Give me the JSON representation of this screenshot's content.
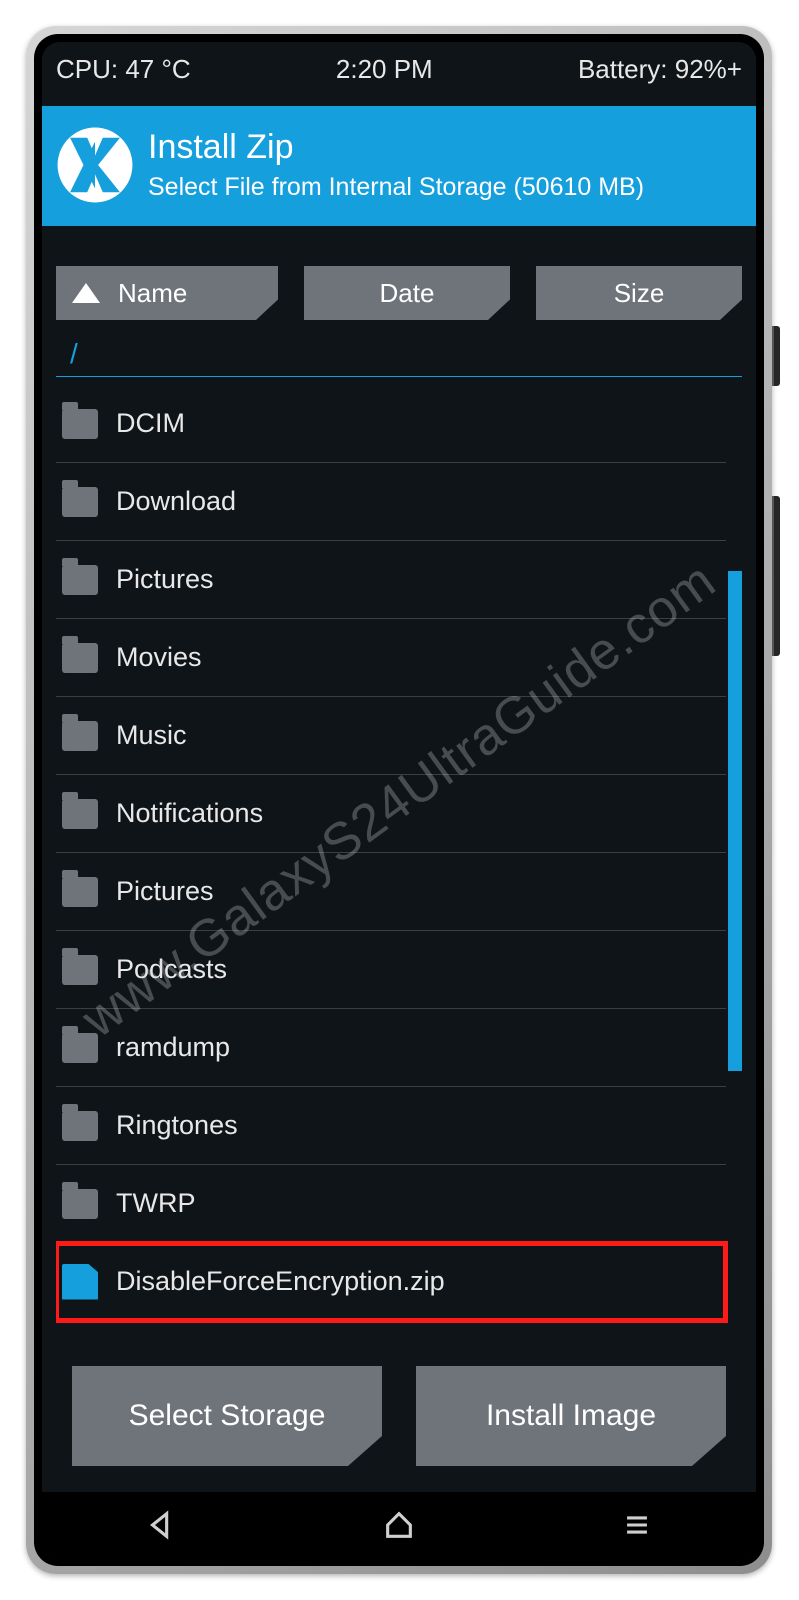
{
  "statusbar": {
    "cpu": "CPU: 47 °C",
    "time": "2:20 PM",
    "battery": "Battery: 92%+"
  },
  "header": {
    "title": "Install Zip",
    "subtitle": "Select File from Internal Storage (50610 MB)"
  },
  "sort": {
    "name": "Name",
    "date": "Date",
    "size": "Size"
  },
  "path": "/",
  "files": [
    {
      "name": "DCIM",
      "type": "folder",
      "highlight": false
    },
    {
      "name": "Download",
      "type": "folder",
      "highlight": false
    },
    {
      "name": "Pictures",
      "type": "folder",
      "highlight": false
    },
    {
      "name": "Movies",
      "type": "folder",
      "highlight": false
    },
    {
      "name": "Music",
      "type": "folder",
      "highlight": false
    },
    {
      "name": "Notifications",
      "type": "folder",
      "highlight": false
    },
    {
      "name": "Pictures",
      "type": "folder",
      "highlight": false
    },
    {
      "name": "Podcasts",
      "type": "folder",
      "highlight": false
    },
    {
      "name": "ramdump",
      "type": "folder",
      "highlight": false
    },
    {
      "name": "Ringtones",
      "type": "folder",
      "highlight": false
    },
    {
      "name": "TWRP",
      "type": "folder",
      "highlight": false
    },
    {
      "name": "DisableForceEncryption.zip",
      "type": "file",
      "highlight": true
    }
  ],
  "actions": {
    "select_storage": "Select Storage",
    "install_image": "Install Image"
  },
  "watermark": "www.GalaxyS24UltraGuide.com"
}
